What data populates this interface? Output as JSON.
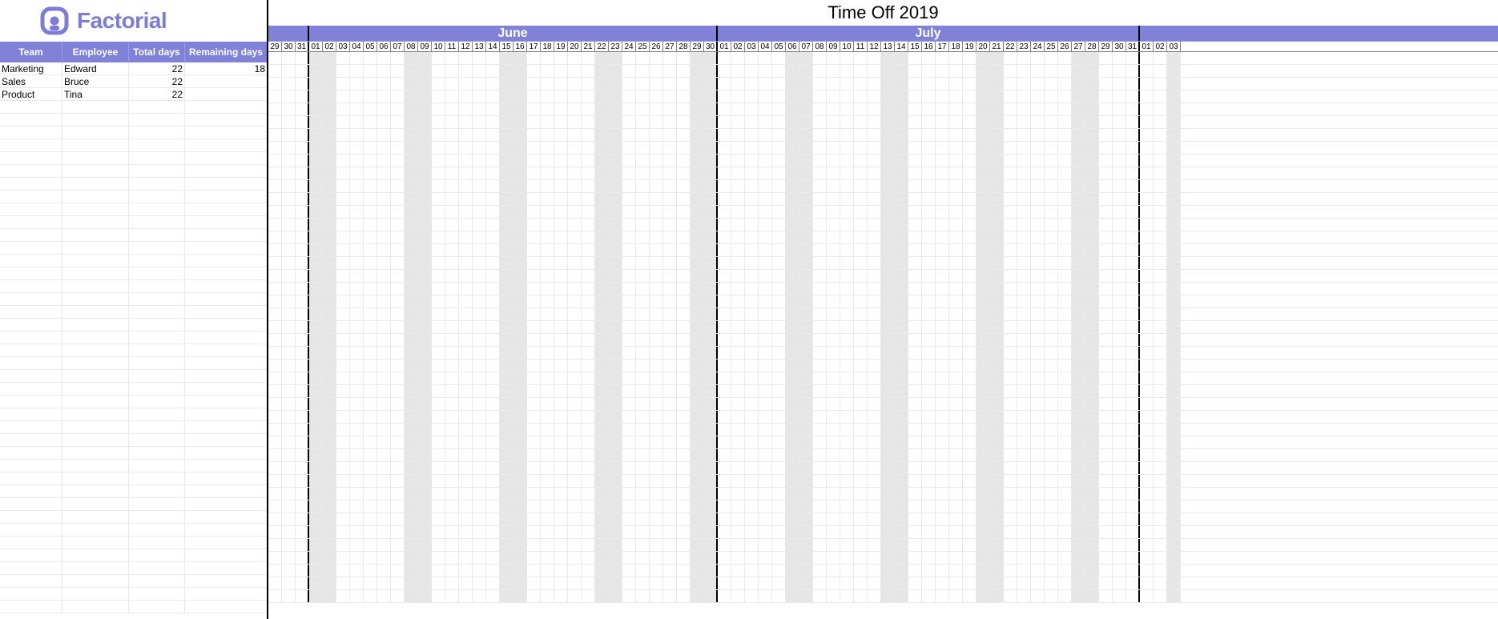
{
  "brand": {
    "name": "Factorial"
  },
  "title": "Time Off 2019",
  "left": {
    "headers": {
      "team": "Team",
      "employee": "Employee",
      "total": "Total days",
      "remaining": "Remaining days"
    },
    "rows": [
      {
        "team": "Marketing",
        "employee": "Edward",
        "total": "22",
        "remaining": "18"
      },
      {
        "team": "Sales",
        "employee": "Bruce",
        "total": "22",
        "remaining": ""
      },
      {
        "team": "Product",
        "employee": "Tina",
        "total": "22",
        "remaining": ""
      }
    ],
    "blankRows": 40
  },
  "calendar": {
    "months": [
      {
        "label": "",
        "days": [
          "29",
          "30",
          "31"
        ],
        "weekendIdx": []
      },
      {
        "label": "June",
        "days": [
          "01",
          "02",
          "03",
          "04",
          "05",
          "06",
          "07",
          "08",
          "09",
          "10",
          "11",
          "12",
          "13",
          "14",
          "15",
          "16",
          "17",
          "18",
          "19",
          "20",
          "21",
          "22",
          "23",
          "24",
          "25",
          "26",
          "27",
          "28",
          "29",
          "30"
        ],
        "weekendIdx": [
          0,
          1,
          7,
          8,
          14,
          15,
          21,
          22,
          28,
          29
        ]
      },
      {
        "label": "July",
        "days": [
          "01",
          "02",
          "03",
          "04",
          "05",
          "06",
          "07",
          "08",
          "09",
          "10",
          "11",
          "12",
          "13",
          "14",
          "15",
          "16",
          "17",
          "18",
          "19",
          "20",
          "21",
          "22",
          "23",
          "24",
          "25",
          "26",
          "27",
          "28",
          "29",
          "30",
          "31"
        ],
        "weekendIdx": [
          5,
          6,
          12,
          13,
          19,
          20,
          26,
          27
        ]
      },
      {
        "label": "",
        "days": [
          "01",
          "02",
          "03"
        ],
        "weekendIdx": [
          2
        ]
      }
    ]
  }
}
